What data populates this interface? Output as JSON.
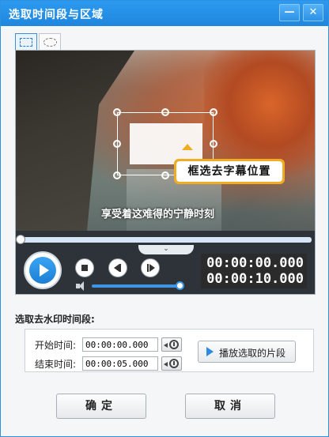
{
  "window": {
    "title": "选取时间段与区域",
    "minimize_symbol": "—",
    "close_symbol": "✕"
  },
  "selection_tools": [
    {
      "name": "rectangle-select-icon",
      "selected": true
    },
    {
      "name": "ellipse-select-icon",
      "selected": false
    }
  ],
  "video": {
    "tooltip": "框选去字幕位置",
    "subtitle": "享受着这难得的宁静时刻",
    "progress_fraction": 0.0,
    "collapse_symbol": "⌄"
  },
  "controls": {
    "volume_fraction": 0.95,
    "current_time": "00:00:00.000",
    "total_time": "00:00:10.000"
  },
  "range": {
    "section_label": "选取去水印时间段:",
    "start_label": "开始时间:",
    "start_value": "00:00:00.000",
    "end_label": "结束时间:",
    "end_value": "00:00:05.000",
    "play_segment_label": "播放选取的片段"
  },
  "buttons": {
    "ok_label": "确定",
    "cancel_label": "取消"
  },
  "colors": {
    "accent": "#1f86dd",
    "tooltip": "#f0ad23",
    "volume": "#3d95e6"
  }
}
